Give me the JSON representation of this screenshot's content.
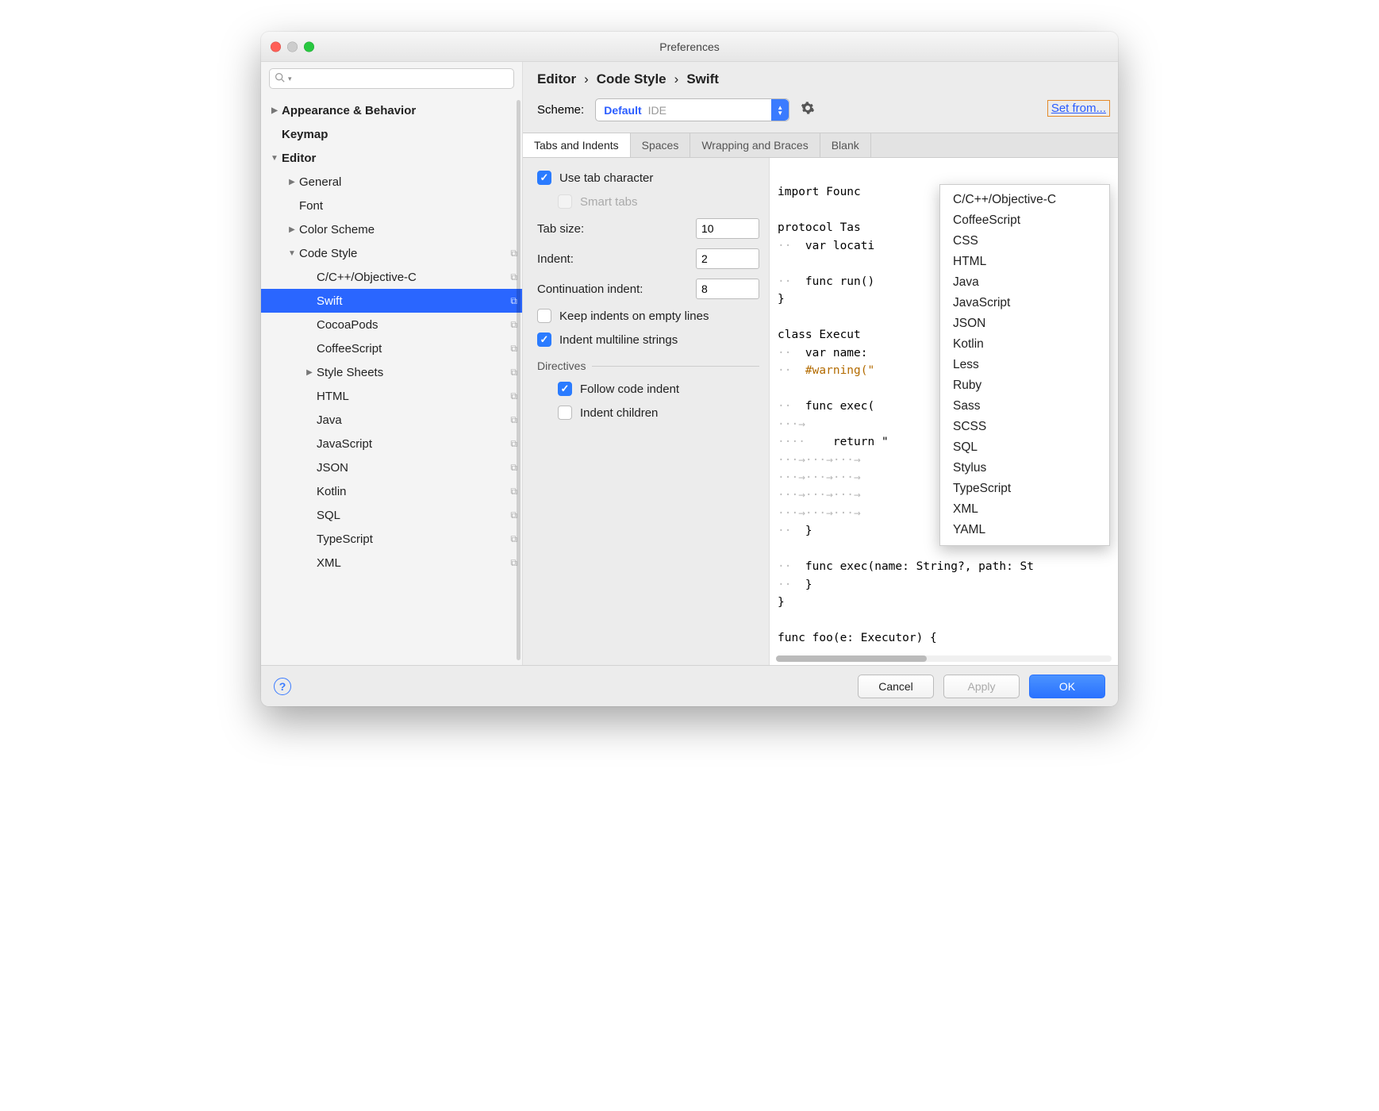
{
  "window": {
    "title": "Preferences"
  },
  "search": {
    "placeholder": ""
  },
  "sidebar": {
    "items": [
      {
        "label": "Appearance & Behavior",
        "depth": 0,
        "arrow": "▶",
        "bold": true
      },
      {
        "label": "Keymap",
        "depth": 0,
        "arrow": "",
        "bold": true
      },
      {
        "label": "Editor",
        "depth": 0,
        "arrow": "▼",
        "bold": true
      },
      {
        "label": "General",
        "depth": 1,
        "arrow": "▶"
      },
      {
        "label": "Font",
        "depth": 1,
        "arrow": ""
      },
      {
        "label": "Color Scheme",
        "depth": 1,
        "arrow": "▶"
      },
      {
        "label": "Code Style",
        "depth": 1,
        "arrow": "▼",
        "copy": true
      },
      {
        "label": "C/C++/Objective-C",
        "depth": 2,
        "arrow": "",
        "copy": true
      },
      {
        "label": "Swift",
        "depth": 2,
        "arrow": "",
        "copy": true,
        "selected": true
      },
      {
        "label": "CocoaPods",
        "depth": 2,
        "arrow": "",
        "copy": true
      },
      {
        "label": "CoffeeScript",
        "depth": 2,
        "arrow": "",
        "copy": true
      },
      {
        "label": "Style Sheets",
        "depth": 2,
        "arrow": "▶",
        "copy": true
      },
      {
        "label": "HTML",
        "depth": 2,
        "arrow": "",
        "copy": true
      },
      {
        "label": "Java",
        "depth": 2,
        "arrow": "",
        "copy": true
      },
      {
        "label": "JavaScript",
        "depth": 2,
        "arrow": "",
        "copy": true
      },
      {
        "label": "JSON",
        "depth": 2,
        "arrow": "",
        "copy": true
      },
      {
        "label": "Kotlin",
        "depth": 2,
        "arrow": "",
        "copy": true
      },
      {
        "label": "SQL",
        "depth": 2,
        "arrow": "",
        "copy": true
      },
      {
        "label": "TypeScript",
        "depth": 2,
        "arrow": "",
        "copy": true
      },
      {
        "label": "XML",
        "depth": 2,
        "arrow": "",
        "copy": true
      }
    ]
  },
  "breadcrumb": {
    "a": "Editor",
    "b": "Code Style",
    "c": "Swift",
    "sep": "›"
  },
  "scheme": {
    "label": "Scheme:",
    "name": "Default",
    "scope": "IDE"
  },
  "setfrom": "Set from...",
  "tabs": [
    {
      "label": "Tabs and Indents",
      "active": true
    },
    {
      "label": "Spaces"
    },
    {
      "label": "Wrapping and Braces"
    },
    {
      "label": "Blank "
    }
  ],
  "opts": {
    "use_tab": "Use tab character",
    "smart_tabs": "Smart tabs",
    "tab_size_l": "Tab size:",
    "tab_size_v": "10",
    "indent_l": "Indent:",
    "indent_v": "2",
    "cont_l": "Continuation indent:",
    "cont_v": "8",
    "keep_empty": "Keep indents on empty lines",
    "multiline": "Indent multiline strings",
    "directives": "Directives",
    "follow": "Follow code indent",
    "children": "Indent children"
  },
  "preview": {
    "l1": "import Founc",
    "l2": "protocol Tas",
    "l3": "  var locati",
    "l4": "  func run()",
    "l5": "}",
    "l6": "class Execut",
    "l7": "  var name: ",
    "l8": "  #warning(\"",
    "l9": "  func exec(",
    "l10": "    return \"",
    "l11": "            {",
    "l12": "            {",
    "l13": "  }",
    "l14": "  func exec(name: String?, path: St",
    "l15": "  }",
    "l16": "}",
    "l17": "func foo(e: Executor) {"
  },
  "menu": [
    "C/C++/Objective-C",
    "CoffeeScript",
    "CSS",
    "HTML",
    "Java",
    "JavaScript",
    "JSON",
    "Kotlin",
    "Less",
    "Ruby",
    "Sass",
    "SCSS",
    "SQL",
    "Stylus",
    "TypeScript",
    "XML",
    "YAML"
  ],
  "footer": {
    "cancel": "Cancel",
    "apply": "Apply",
    "ok": "OK"
  }
}
